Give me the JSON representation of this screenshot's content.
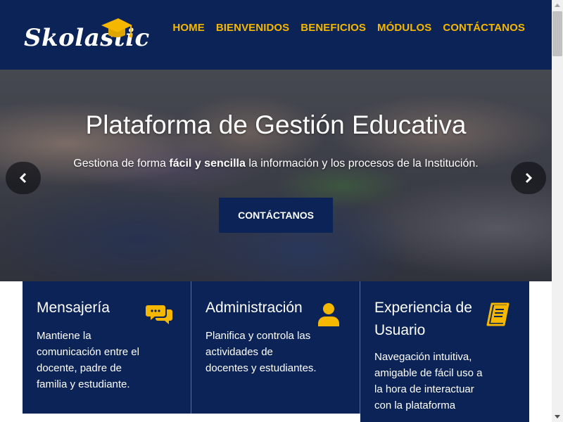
{
  "brand": {
    "name": "Skolastic"
  },
  "nav": {
    "items": [
      {
        "label": "HOME"
      },
      {
        "label": "BIENVENIDOS"
      },
      {
        "label": "BENEFICIOS"
      },
      {
        "label": "MÓDULOS"
      },
      {
        "label": "CONTÁCTANOS"
      }
    ]
  },
  "hero": {
    "title": "Plataforma de Gestión Educativa",
    "subtitle_prefix": "Gestiona de forma ",
    "subtitle_bold": "fácil y sencilla",
    "subtitle_suffix": " la información y los procesos de la Institución.",
    "button_label": "CONTÁCTANOS"
  },
  "cards": [
    {
      "title": "Mensajería",
      "icon": "chat-bubbles-icon",
      "description": "Mantiene la comunicación entre el docente, padre de familia y estudiante."
    },
    {
      "title": "Administración",
      "icon": "user-icon",
      "description": "Planifica y controla las actividades de docentes y estudiantes."
    },
    {
      "title": "Experiencia de Usuario",
      "icon": "book-icon",
      "description": "Navegación intuitiva, amigable de fácil uso a la hora de interactuar con la plataforma"
    }
  ],
  "colors": {
    "navy": "#0b2356",
    "accent_gold": "#f5b700",
    "white": "#ffffff"
  }
}
